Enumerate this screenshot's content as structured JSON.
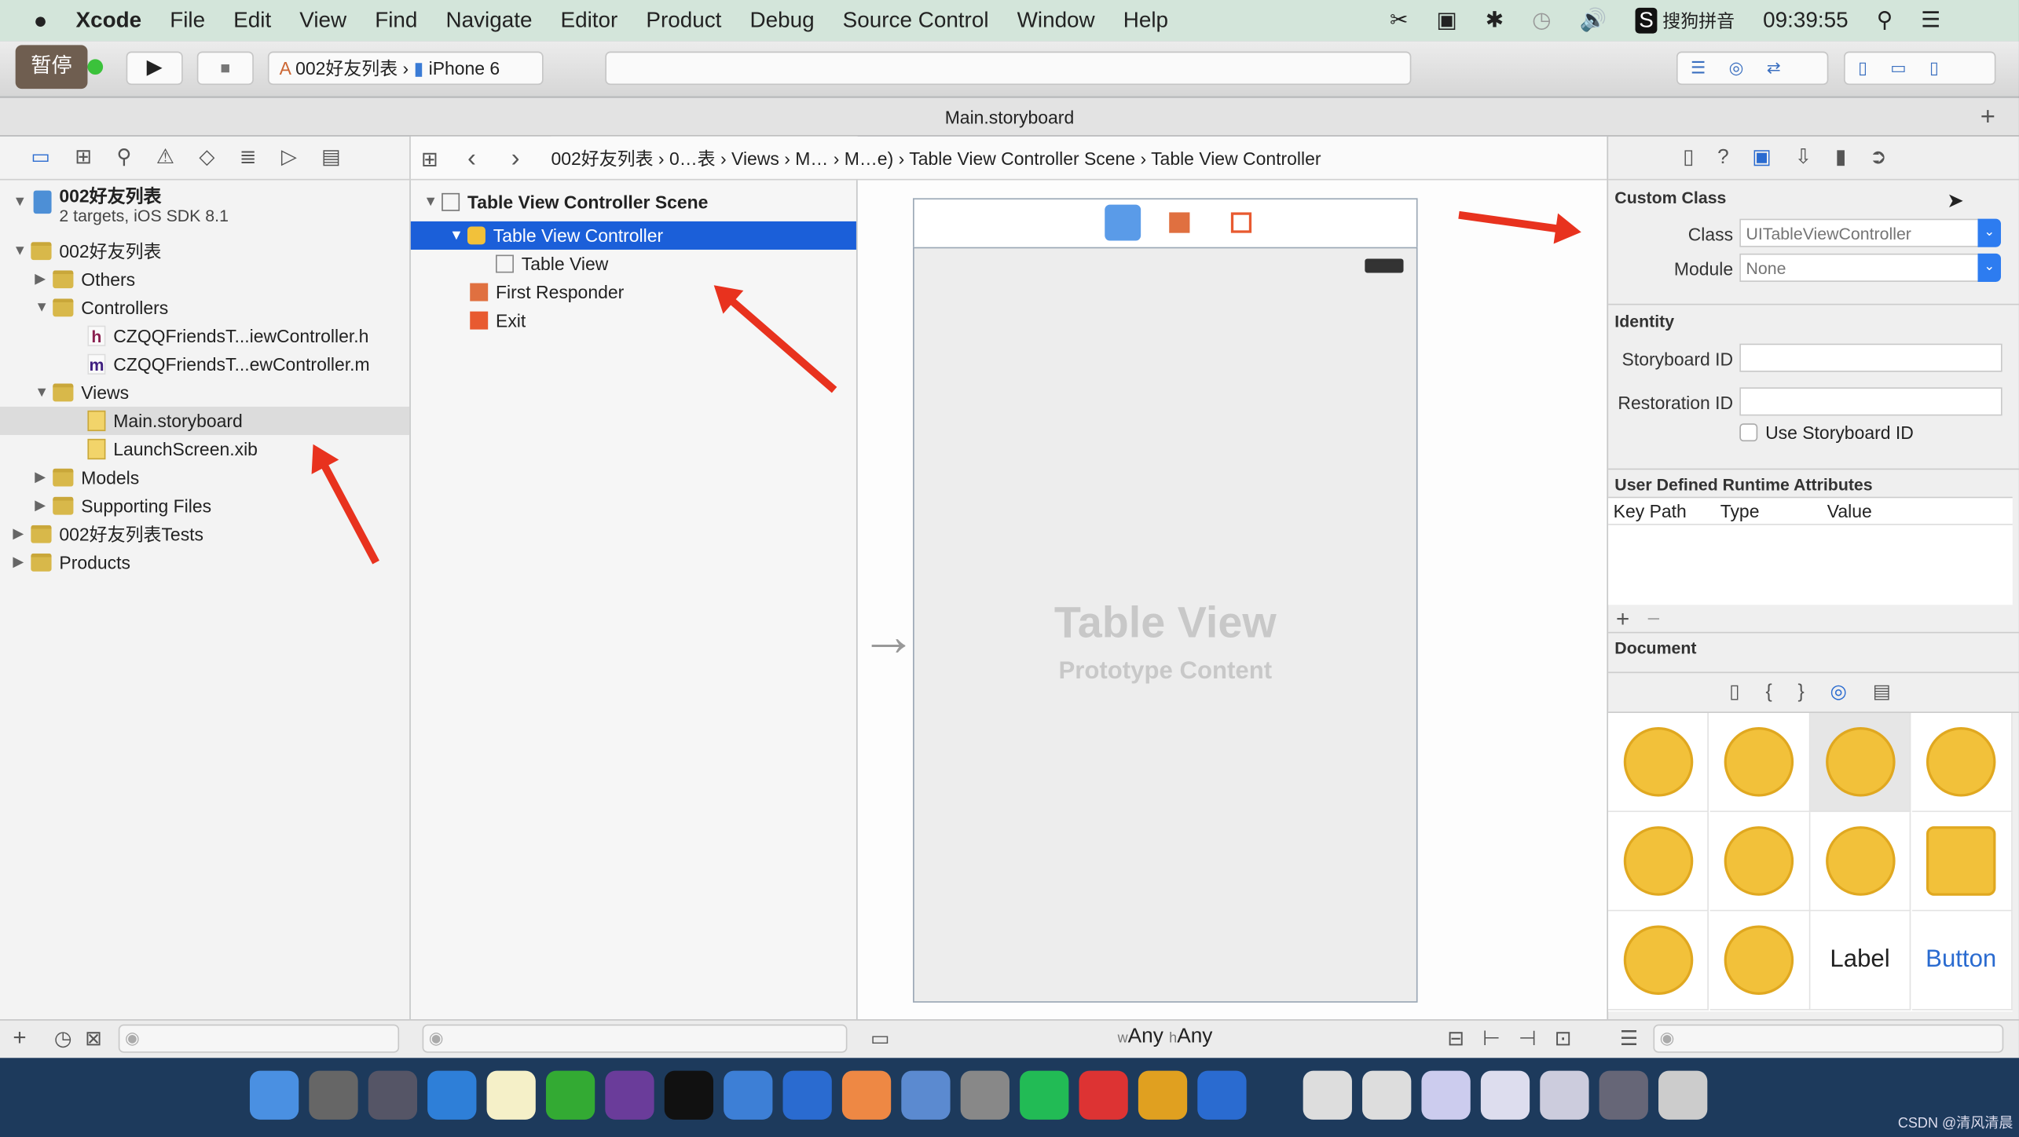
{
  "menubar": {
    "apple": "",
    "app": "Xcode",
    "items": [
      "File",
      "Edit",
      "View",
      "Find",
      "Navigate",
      "Editor",
      "Product",
      "Debug",
      "Source Control",
      "Window",
      "Help"
    ],
    "ime": "搜狗拼音",
    "clock": "09:39:55"
  },
  "toolbar": {
    "pause_label": "暂停",
    "scheme": "002好友列表",
    "device": "iPhone 6"
  },
  "tab": {
    "title": "Main.storyboard"
  },
  "jumpbar": [
    "002好友列表",
    "0…表",
    "Views",
    "M…",
    "M…e)",
    "Table View Controller Scene",
    "Table View Controller"
  ],
  "navigator": {
    "project": "002好友列表",
    "project_sub": "2 targets, iOS SDK 8.1",
    "items": [
      {
        "label": "002好友列表",
        "level": 1,
        "open": true
      },
      {
        "label": "Others",
        "level": 2,
        "open": false
      },
      {
        "label": "Controllers",
        "level": 2,
        "open": true
      },
      {
        "label": "CZQQFriendsT...iewController.h",
        "level": 3,
        "file": "h"
      },
      {
        "label": "CZQQFriendsT...ewController.m",
        "level": 3,
        "file": "m"
      },
      {
        "label": "Views",
        "level": 2,
        "open": true
      },
      {
        "label": "Main.storyboard",
        "level": 3,
        "file": "sb",
        "selected": true
      },
      {
        "label": "LaunchScreen.xib",
        "level": 3,
        "file": "xib"
      },
      {
        "label": "Models",
        "level": 2,
        "open": false
      },
      {
        "label": "Supporting Files",
        "level": 2,
        "open": false
      },
      {
        "label": "002好友列表Tests",
        "level": 1,
        "open": false
      },
      {
        "label": "Products",
        "level": 1,
        "open": false
      }
    ]
  },
  "outline": {
    "scene": "Table View Controller Scene",
    "controller": "Table View Controller",
    "table": "Table View",
    "responder": "First Responder",
    "exit": "Exit"
  },
  "canvas": {
    "title": "Table View",
    "subtitle": "Prototype Content",
    "size_w": "Any",
    "size_h": "Any",
    "w": "w",
    "h": "h"
  },
  "inspector": {
    "custom_class": "Custom Class",
    "class_label": "Class",
    "class_placeholder": "UITableViewController",
    "module_label": "Module",
    "module_placeholder": "None",
    "identity": "Identity",
    "storyboard_id_label": "Storyboard ID",
    "restoration_id_label": "Restoration ID",
    "use_storyboard_id": "Use Storyboard ID",
    "use_storyboard_checked": false,
    "runtime_attrs": "User Defined Runtime Attributes",
    "cols": [
      "Key Path",
      "Type",
      "Value"
    ],
    "document": "Document",
    "library_label": "Label",
    "library_button": "Button"
  },
  "watermark": "CSDN @清风清晨",
  "colors": {
    "selection": "#1b5fd9",
    "arrow": "#e8321e",
    "folder": "#d8b84a",
    "menubar": "#d3e5da"
  }
}
